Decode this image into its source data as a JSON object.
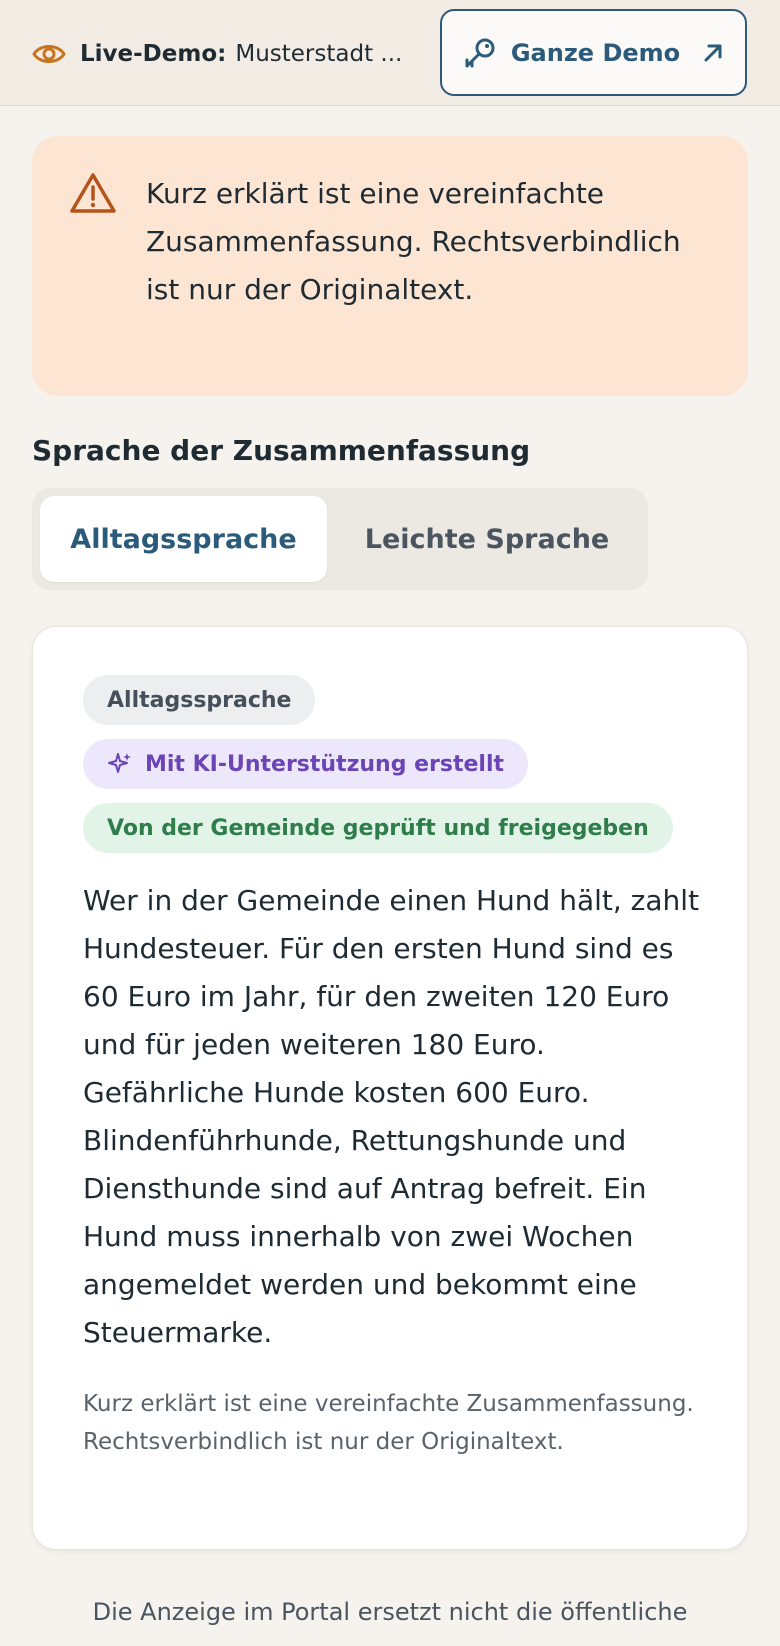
{
  "topbar": {
    "live_label": "Live-Demo:",
    "live_value": "Musterstadt ...",
    "demo_button": "Ganze Demo"
  },
  "warning": {
    "text": "Kurz erklärt ist eine vereinfachte Zusammenfassung. Rechtsverbindlich ist nur der Originaltext."
  },
  "language": {
    "title": "Sprache der Zusammenfassung",
    "options": [
      "Alltagssprache",
      "Leichte Sprache"
    ],
    "selected": "Alltagssprache"
  },
  "card": {
    "badges": {
      "level": "Alltagssprache",
      "ai": "Mit KI-Unterstützung erstellt",
      "approved": "Von der Gemeinde geprüft und freigegeben"
    },
    "summary": "Wer in der Gemeinde einen Hund hält, zahlt Hundesteuer. Für den ersten Hund sind es 60 Euro im Jahr, für den zweiten 120 Euro und für jeden weiteren 180 Euro. Gefährliche Hunde kosten 600 Euro. Blindenführhunde, Rettungshunde und Diensthunde sind auf Antrag befreit. Ein Hund muss innerhalb von zwei Wochen angemeldet werden und bekommt eine Steuermarke.",
    "note": "Kurz erklärt ist eine vereinfachte Zusammenfassung. Rechtsverbindlich ist nur der Originaltext."
  },
  "footer": {
    "text": "Die Anzeige im Portal ersetzt nicht die öffentliche"
  },
  "colors": {
    "accent": "#2c5a7a",
    "warning_bg": "#fde5d3",
    "warning_icon": "#b4541a",
    "ai_purple": "#6b45b5",
    "approved_green": "#2f7d4b"
  },
  "icons": [
    "eye-icon",
    "key-icon",
    "arrow-up-right-icon",
    "warning-icon",
    "sparkle-icon"
  ]
}
